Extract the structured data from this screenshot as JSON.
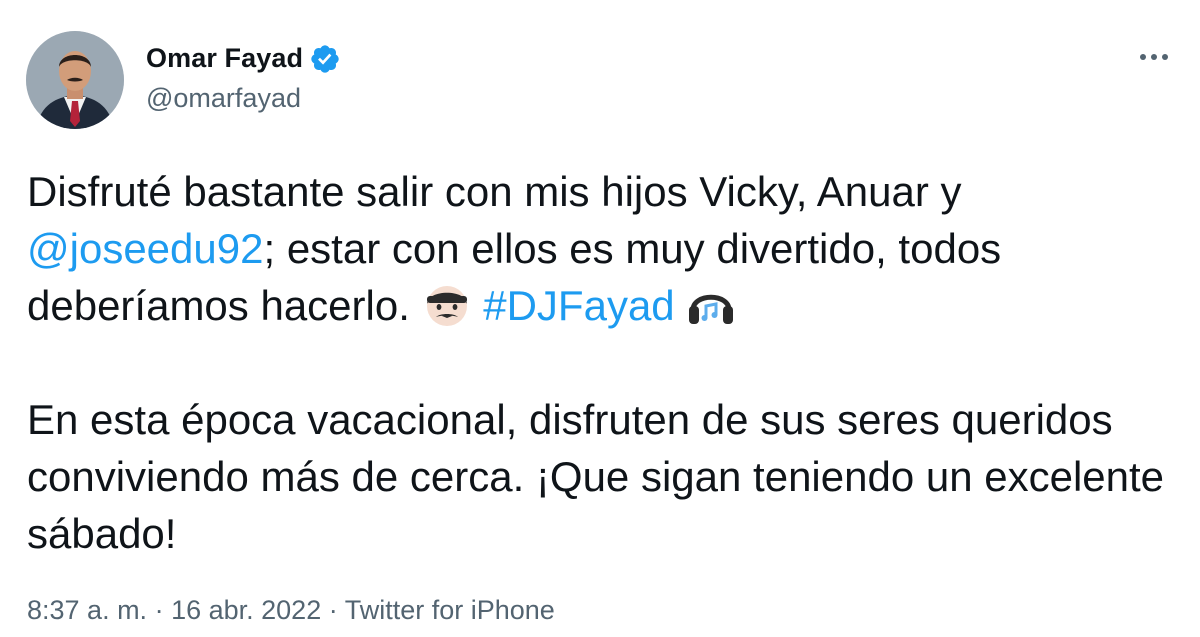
{
  "author": {
    "display_name": "Omar Fayad",
    "handle": "@omarfayad",
    "verified": true
  },
  "tweet": {
    "para1": {
      "line1": "Disfruté bastante salir con mis hijos Vicky, Anuar y ",
      "mention": "@joseedu92",
      "line2": "; estar con ellos es muy divertido, todos deberíamos hacerlo. ",
      "hashtag": "#DJFayad",
      "emoji_1": "man-emoji",
      "emoji_2": "headphones-emoji"
    },
    "para2": "En esta época vacacional, disfruten de sus seres queridos conviviendo más de cerca. ¡Que sigan teniendo un excelente sábado!"
  },
  "meta": {
    "time": "8:37 a. m.",
    "separator": " · ",
    "date": "16 abr. 2022",
    "source": "Twitter for iPhone"
  },
  "colors": {
    "link": "#1d9bf0",
    "text": "#0f1419",
    "secondary": "#536471"
  },
  "icons": {
    "more": "more-horizontal-icon",
    "verified": "verified-badge-icon"
  }
}
